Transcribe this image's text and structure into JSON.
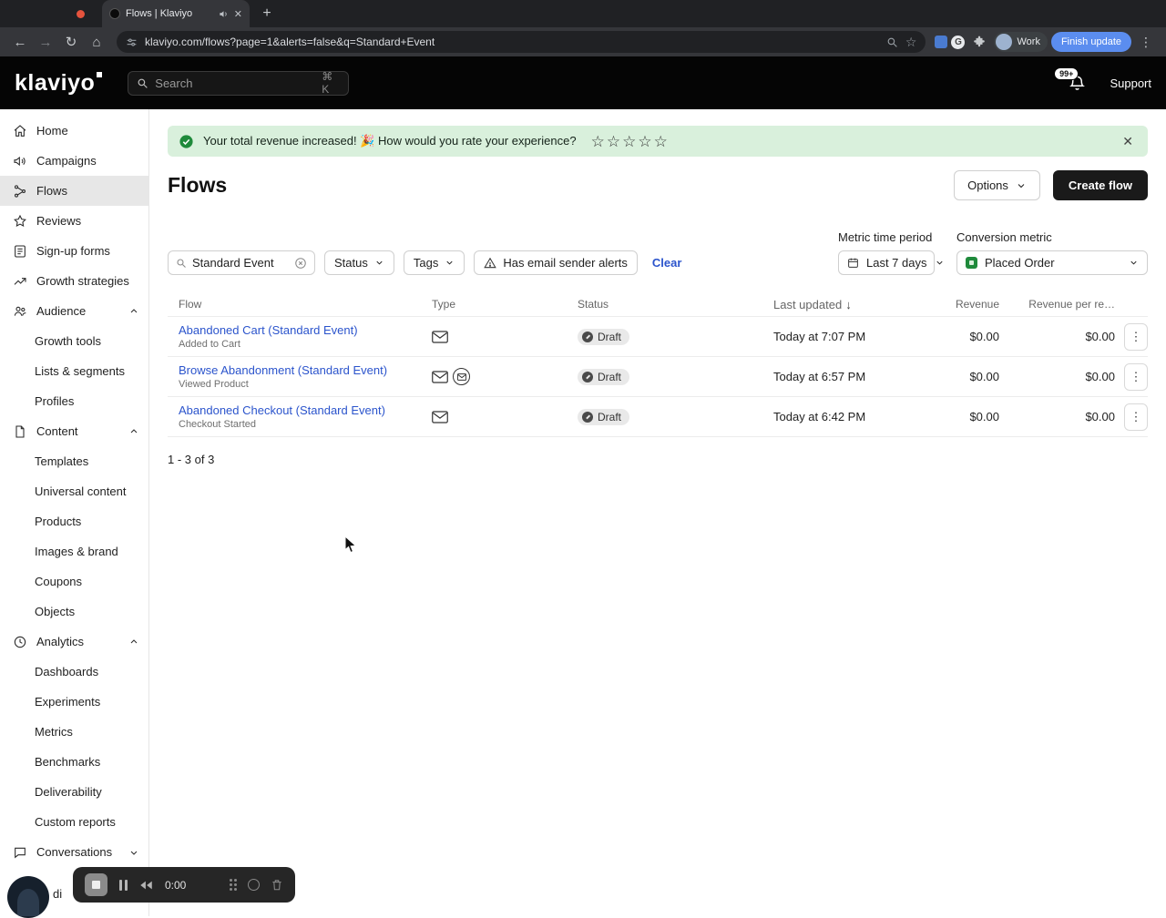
{
  "browser": {
    "tab_title": "Flows | Klaviyo",
    "url": "klaviyo.com/flows?page=1&alerts=false&q=Standard+Event",
    "profile_label": "Work",
    "update_label": "Finish update",
    "extension_g": "G"
  },
  "icons": {
    "back_arrow": "←",
    "forward_arrow": "→",
    "reload": "↻",
    "home": "⌂",
    "new_tab_plus": "+",
    "close": "✕",
    "kebab": "⋮",
    "star_outline": "☆",
    "sort_desc": "↓"
  },
  "header": {
    "logo_text": "klaviyo",
    "search_placeholder": "Search",
    "search_shortcut": "⌘ K",
    "notifications_badge": "99+",
    "support_label": "Support"
  },
  "sidebar": {
    "items": [
      {
        "label": "Home"
      },
      {
        "label": "Campaigns"
      },
      {
        "label": "Flows"
      },
      {
        "label": "Reviews"
      },
      {
        "label": "Sign-up forms"
      },
      {
        "label": "Growth strategies"
      },
      {
        "label": "Audience"
      },
      {
        "label": "Growth tools"
      },
      {
        "label": "Lists & segments"
      },
      {
        "label": "Profiles"
      },
      {
        "label": "Content"
      },
      {
        "label": "Templates"
      },
      {
        "label": "Universal content"
      },
      {
        "label": "Products"
      },
      {
        "label": "Images & brand"
      },
      {
        "label": "Coupons"
      },
      {
        "label": "Objects"
      },
      {
        "label": "Analytics"
      },
      {
        "label": "Dashboards"
      },
      {
        "label": "Experiments"
      },
      {
        "label": "Metrics"
      },
      {
        "label": "Benchmarks"
      },
      {
        "label": "Deliverability"
      },
      {
        "label": "Custom reports"
      },
      {
        "label": "Conversations"
      }
    ],
    "user_partial": "di"
  },
  "main": {
    "banner": {
      "message": "Your total revenue increased! 🎉 How would you rate your experience?"
    },
    "page_title": "Flows",
    "options_label": "Options",
    "create_flow_label": "Create flow",
    "filters": {
      "search_value": "Standard Event",
      "status_label": "Status",
      "tags_label": "Tags",
      "alerts_label": "Has email sender alerts",
      "clear_label": "Clear",
      "metric_time_label": "Metric time period",
      "metric_time_value": "Last 7 days",
      "conversion_label": "Conversion metric",
      "conversion_value": "Placed Order"
    },
    "table": {
      "columns": {
        "flow": "Flow",
        "type": "Type",
        "status": "Status",
        "updated": "Last updated",
        "revenue": "Revenue",
        "revenue_per": "Revenue per re…"
      },
      "rows": [
        {
          "name": "Abandoned Cart (Standard Event)",
          "trigger": "Added to Cart",
          "status": "Draft",
          "updated": "Today at 7:07 PM",
          "revenue": "$0.00",
          "revenue_per": "$0.00"
        },
        {
          "name": "Browse Abandonment (Standard Event)",
          "trigger": "Viewed Product",
          "status": "Draft",
          "updated": "Today at 6:57 PM",
          "revenue": "$0.00",
          "revenue_per": "$0.00"
        },
        {
          "name": "Abandoned Checkout (Standard Event)",
          "trigger": "Checkout Started",
          "status": "Draft",
          "updated": "Today at 6:42 PM",
          "revenue": "$0.00",
          "revenue_per": "$0.00"
        }
      ],
      "pagination": "1 - 3 of 3"
    }
  },
  "recorder": {
    "time": "0:00"
  },
  "colors": {
    "link_blue": "#2b54cc",
    "banner_bg": "#d9f0dc",
    "success_green": "#1f8a3b",
    "create_button_bg": "#1a1a1a",
    "update_pill_blue": "#5b8def"
  }
}
